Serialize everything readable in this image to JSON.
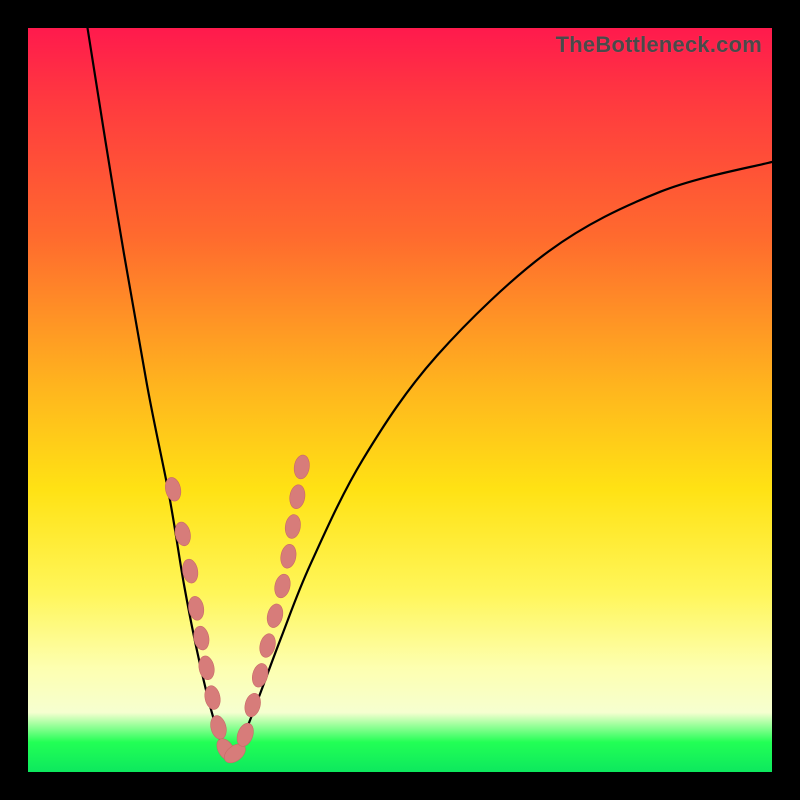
{
  "watermark": "TheBottleneck.com",
  "colors": {
    "bead": "#d77c7a",
    "bead_stroke": "#c96a67",
    "curve": "#000000",
    "gradient_top": "#ff1a4d",
    "gradient_bottom": "#0de85e"
  },
  "chart_data": {
    "type": "line",
    "title": "",
    "xlabel": "",
    "ylabel": "",
    "xlim": [
      0,
      100
    ],
    "ylim": [
      0,
      100
    ],
    "grid": false,
    "legend": false,
    "note": "x in percent across width, y in percent where 0 = top, 100 = bottom; curve is a V-shaped dip bottoming near x≈27",
    "series": [
      {
        "name": "bottleneck-curve",
        "x": [
          8,
          12,
          16,
          19,
          21,
          23,
          25,
          27,
          29,
          31,
          34,
          38,
          45,
          55,
          70,
          85,
          100
        ],
        "y": [
          0,
          25,
          48,
          63,
          75,
          85,
          93,
          98,
          95,
          90,
          82,
          72,
          58,
          44,
          30,
          22,
          18
        ]
      }
    ],
    "beads": {
      "note": "pink lozenge markers along both arms near the trough",
      "points": [
        {
          "x": 19.5,
          "y": 62
        },
        {
          "x": 20.8,
          "y": 68
        },
        {
          "x": 21.8,
          "y": 73
        },
        {
          "x": 22.6,
          "y": 78
        },
        {
          "x": 23.3,
          "y": 82
        },
        {
          "x": 24.0,
          "y": 86
        },
        {
          "x": 24.8,
          "y": 90
        },
        {
          "x": 25.6,
          "y": 94
        },
        {
          "x": 26.6,
          "y": 97
        },
        {
          "x": 27.8,
          "y": 97.5
        },
        {
          "x": 29.2,
          "y": 95
        },
        {
          "x": 30.2,
          "y": 91
        },
        {
          "x": 31.2,
          "y": 87
        },
        {
          "x": 32.2,
          "y": 83
        },
        {
          "x": 33.2,
          "y": 79
        },
        {
          "x": 34.2,
          "y": 75
        },
        {
          "x": 35.0,
          "y": 71
        },
        {
          "x": 35.6,
          "y": 67
        },
        {
          "x": 36.2,
          "y": 63
        },
        {
          "x": 36.8,
          "y": 59
        }
      ]
    }
  }
}
